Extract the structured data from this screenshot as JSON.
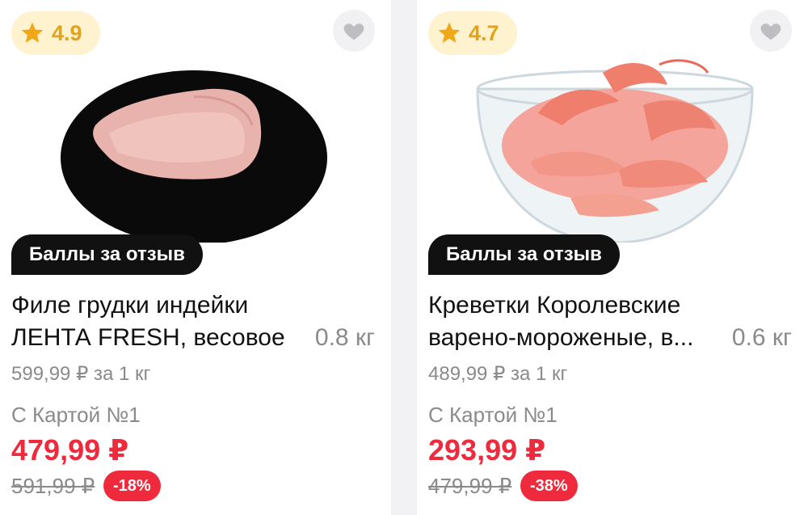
{
  "products": [
    {
      "rating": "4.9",
      "bonus_label": "Баллы за отзыв",
      "name": "Филе грудки индейки\nЛЕНТА FRESH, весовое",
      "weight": "0.8 кг",
      "unit_price": "599,99 ₽ за 1 кг",
      "card_label": "С Картой №1",
      "price": "479,99 ₽",
      "old_price": "591,99 ₽",
      "discount": "-18%",
      "icons": {
        "rating": "star-icon",
        "favorite": "heart-icon"
      }
    },
    {
      "rating": "4.7",
      "bonus_label": "Баллы за отзыв",
      "name": "Креветки Королевские\nварено-мороженые, в...",
      "weight": "0.6 кг",
      "unit_price": "489,99 ₽ за 1 кг",
      "card_label": "С Картой №1",
      "price": "293,99 ₽",
      "old_price": "479,99 ₽",
      "discount": "-38%",
      "icons": {
        "rating": "star-icon",
        "favorite": "heart-icon"
      }
    }
  ],
  "colors": {
    "accent_red": "#ee2a3c",
    "rating_star": "#f0a818",
    "rating_bg": "#fff3cf",
    "bonus_bg": "#111111"
  }
}
